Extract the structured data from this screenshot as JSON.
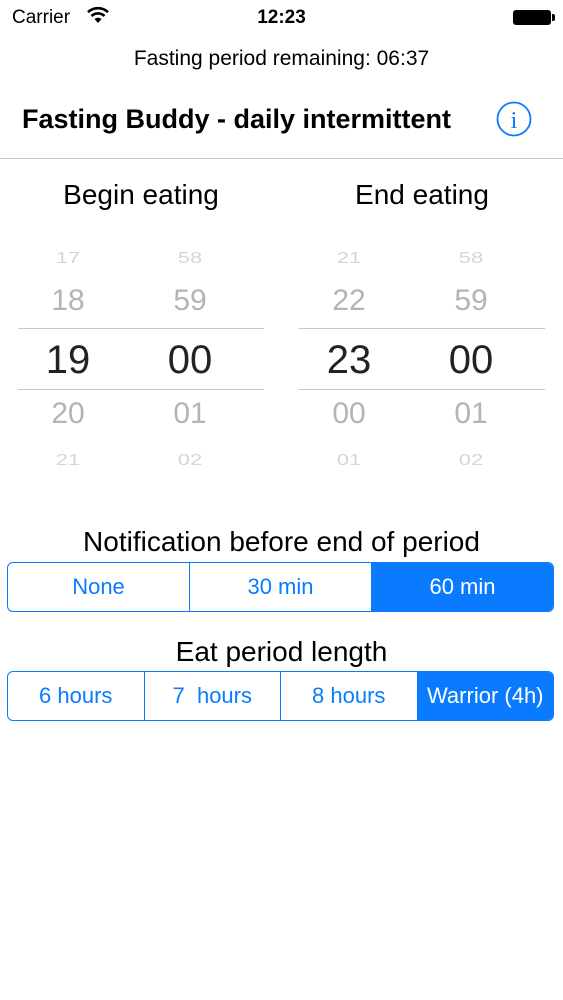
{
  "status_bar": {
    "carrier": "Carrier",
    "time": "12:23"
  },
  "remaining": "Fasting period remaining: 06:37",
  "header": {
    "title": "Fasting Buddy - daily intermittent",
    "info_icon": "info-circle-icon"
  },
  "begin": {
    "title": "Begin eating",
    "hours": [
      "17",
      "18",
      "19",
      "20",
      "21"
    ],
    "minutes": [
      "58",
      "59",
      "00",
      "01",
      "02"
    ]
  },
  "end": {
    "title": "End eating",
    "hours": [
      "21",
      "22",
      "23",
      "00",
      "01"
    ],
    "minutes": [
      "58",
      "59",
      "00",
      "01",
      "02"
    ]
  },
  "notification": {
    "label": "Notification before end of period",
    "options": [
      "None",
      "30 min",
      "60 min"
    ],
    "selected": "60 min"
  },
  "eat_period": {
    "label": "Eat period length",
    "options": [
      "6 hours",
      "7  hours",
      "8 hours",
      "Warrior (4h)"
    ],
    "selected": "Warrior (4h)"
  },
  "colors": {
    "accent": "#0a7bff",
    "divider": "#c8c7cc"
  }
}
